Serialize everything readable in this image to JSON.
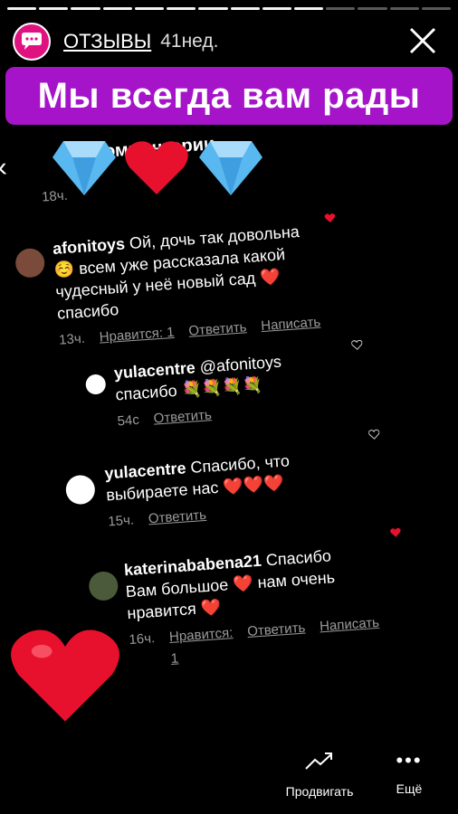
{
  "story": {
    "progress": {
      "total": 14,
      "done": 10
    },
    "profile_name": "ОТЗЫВЫ",
    "time_ago": "41нед.",
    "banner_text": "Мы всегда вам рады"
  },
  "comments_screen": {
    "title": "Комментарии",
    "first_time": "18ч.",
    "comments": [
      {
        "user": "afonitoys",
        "text": "Ой, дочь так довольна ☺️ всем уже рассказала какой чудесный у неё новый сад ❤️ спасибо",
        "time": "13ч.",
        "likes": "Нравится: 1",
        "reply": "Ответить",
        "write": "Написать"
      },
      {
        "user": "yulacentre",
        "text": "@afonitoys спасибо 💐💐💐💐",
        "time": "54с",
        "reply": "Ответить"
      },
      {
        "user": "yulacentre",
        "text": "Спасибо, что выбираете нас ❤️❤️❤️",
        "time": "15ч.",
        "reply": "Ответить"
      },
      {
        "user": "katerinababena21",
        "text": "Спасибо Вам большое ❤️ нам очень нравится ❤️",
        "time": "16ч.",
        "likes": "Нравится: 1",
        "reply": "Ответить",
        "write": "Написать"
      }
    ]
  },
  "bottom_bar": {
    "promote_label": "Продвигать",
    "more_label": "Ещё"
  },
  "colors": {
    "banner": "#a514c8",
    "avatar": "#e0127f",
    "heart": "#e8112d",
    "gem": "#5ab8f0"
  }
}
